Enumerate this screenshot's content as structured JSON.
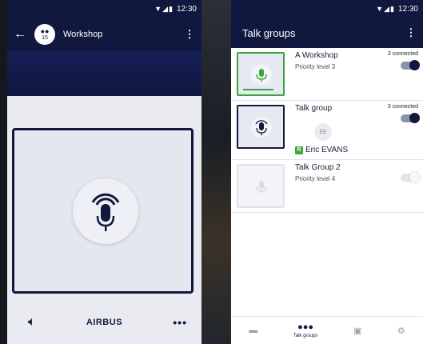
{
  "left_phone": {
    "status": {
      "time": "12:30"
    },
    "header": {
      "title": "Workshop",
      "member_count": "15"
    },
    "brand": "AIRBUS"
  },
  "right_phone": {
    "status": {
      "time": "12:30"
    },
    "header": {
      "title": "Talk groups"
    },
    "groups": [
      {
        "name": "A Workshop",
        "subtitle": "Priority level 3",
        "connected": "3 connected",
        "enabled": true,
        "state": "active"
      },
      {
        "name": "Talk group",
        "connected": "3 connected",
        "enabled": true,
        "state": "speaking",
        "speaker_initials": "EE",
        "speaker_badge": "R",
        "speaker_name": "Eric EVANS"
      },
      {
        "name": "Talk Group 2",
        "subtitle": "Priority level 4",
        "enabled": false,
        "state": "inactive"
      }
    ],
    "bottom_nav": [
      {
        "icon": "chat-icon",
        "label": ""
      },
      {
        "icon": "groups-icon",
        "label": "Talk groups",
        "active": true
      },
      {
        "icon": "contacts-icon",
        "label": ""
      },
      {
        "icon": "settings-icon",
        "label": ""
      }
    ]
  },
  "colors": {
    "navy": "#11183f",
    "green": "#3fa33c",
    "panel": "#e9ebf1"
  }
}
